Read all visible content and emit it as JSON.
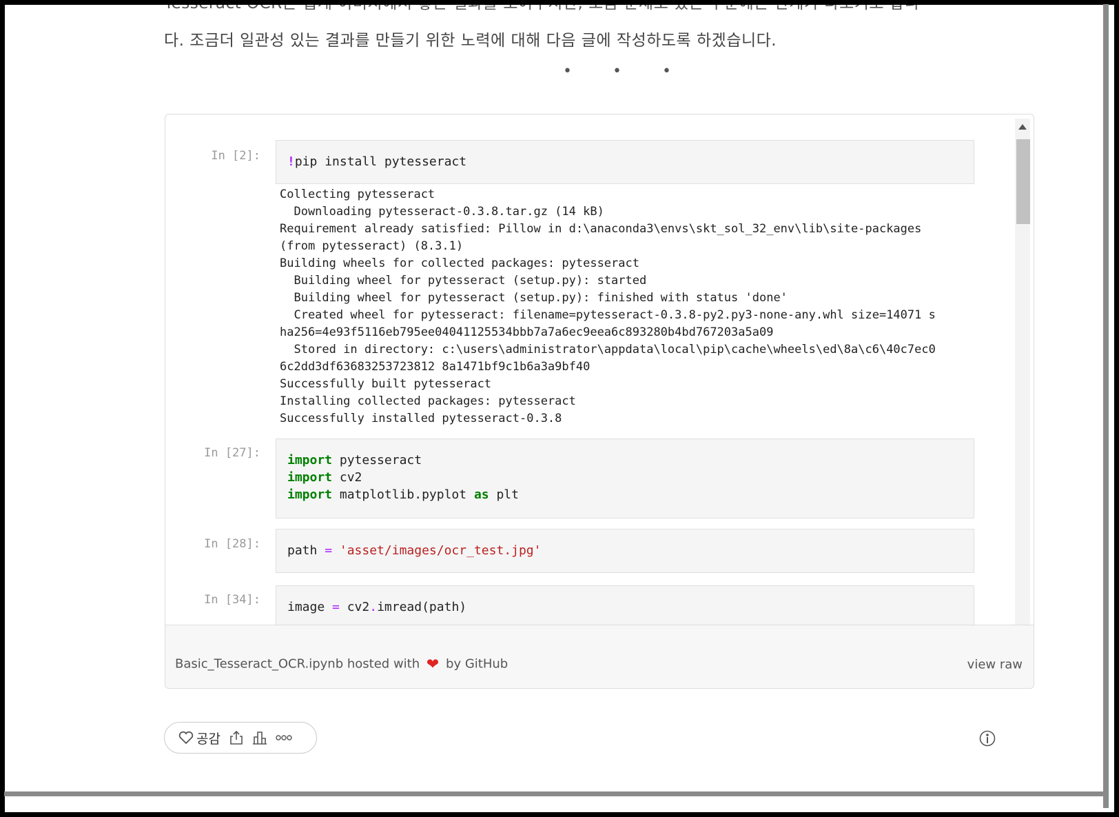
{
  "article": {
    "partial_line": "Tesseract OCR은 쉽게 이미지에서 좋은 결과를 보여주지만, 조금 문제도 있는 부분에는 한계가 나오기도 합니",
    "line2": "다. 조금더 일관성 있는 결과를 만들기 위한 노력에 대해 다음 글에 작성하도록 하겠습니다.",
    "separator": "• • •"
  },
  "notebook": {
    "cells": [
      {
        "prompt": "In [2]:",
        "code": [
          "!pip install pytesseract"
        ]
      },
      {
        "prompt": "In [27]:",
        "code": [
          "import pytesseract",
          "import cv2",
          "import matplotlib.pyplot as plt"
        ]
      },
      {
        "prompt": "In [28]:",
        "code": [
          "path = 'asset/images/ocr_test.jpg'"
        ]
      },
      {
        "prompt": "In [34]:",
        "code": [
          "image = cv2.imread(path)"
        ]
      }
    ],
    "output": [
      "Collecting pytesseract",
      "  Downloading pytesseract-0.3.8.tar.gz (14 kB)",
      "Requirement already satisfied: Pillow in d:\\anaconda3\\envs\\skt_sol_32_env\\lib\\site-packages",
      "(from pytesseract) (8.3.1)",
      "Building wheels for collected packages: pytesseract",
      "  Building wheel for pytesseract (setup.py): started",
      "  Building wheel for pytesseract (setup.py): finished with status 'done'",
      "  Created wheel for pytesseract: filename=pytesseract-0.3.8-py2.py3-none-any.whl size=14071 s",
      "ha256=4e93f5116eb795ee04041125534bbb7a7a6ec9eea6c893280b4bd767203a5a09",
      "  Stored in directory: c:\\users\\administrator\\appdata\\local\\pip\\cache\\wheels\\ed\\8a\\c6\\40c7ec0",
      "6c2dd3df63683253723812 8a1471bf9c1b6a3a9bf40",
      "Successfully built pytesseract",
      "Installing collected packages: pytesseract",
      "Successfully installed pytesseract-0.3.8"
    ]
  },
  "gist_footer": {
    "filename": "Basic_Tesseract_OCR.ipynb",
    "hosted_with": "hosted with",
    "by": "by GitHub",
    "view_raw": "view raw"
  },
  "reactions": {
    "like_label": "공감"
  },
  "colors": {
    "keyword": "#008000",
    "string": "#ba2121",
    "magic": "#aa22ff",
    "heart": "#e02424"
  }
}
